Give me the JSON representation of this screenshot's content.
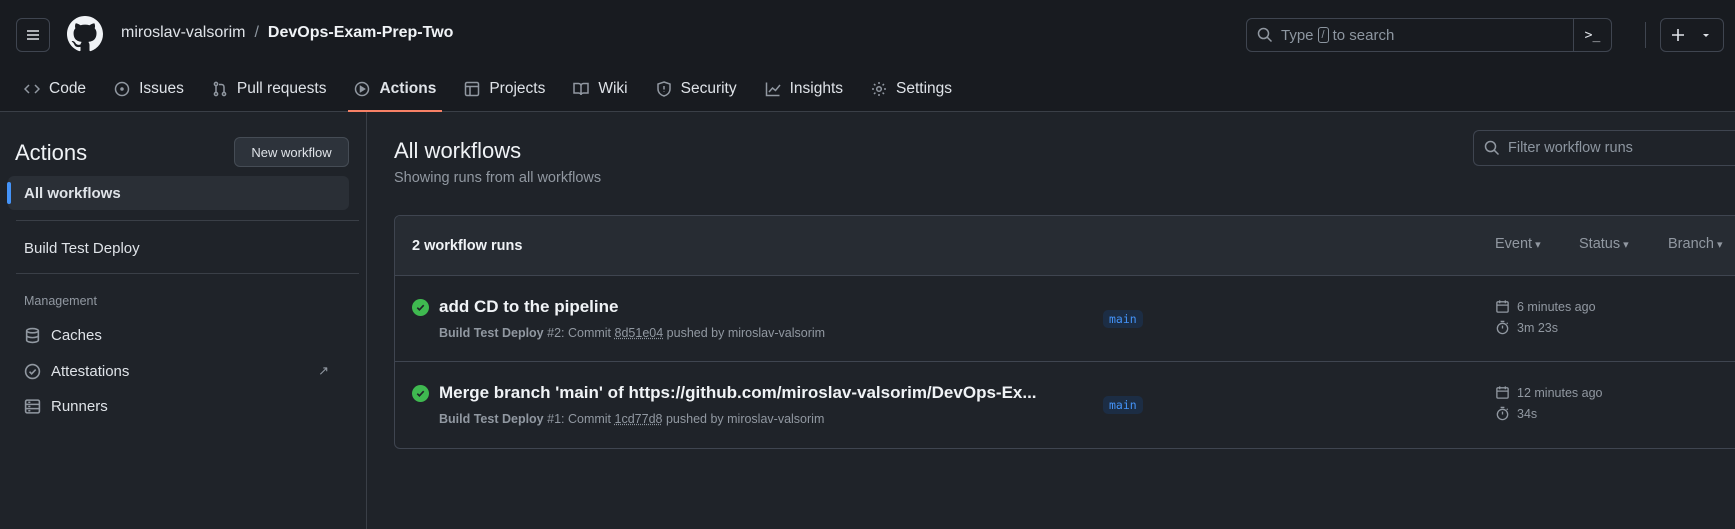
{
  "header": {
    "owner": "miroslav-valsorim",
    "separator": "/",
    "repo": "DevOps-Exam-Prep-Two",
    "search_prefix": "Type",
    "search_key": "/",
    "search_suffix": "to search",
    "plus_icon": "plus-icon"
  },
  "tabs": [
    {
      "label": "Code",
      "icon": "code-icon"
    },
    {
      "label": "Issues",
      "icon": "issue-icon"
    },
    {
      "label": "Pull requests",
      "icon": "pull-request-icon"
    },
    {
      "label": "Actions",
      "icon": "play-icon",
      "active": true
    },
    {
      "label": "Projects",
      "icon": "table-icon"
    },
    {
      "label": "Wiki",
      "icon": "book-icon"
    },
    {
      "label": "Security",
      "icon": "shield-icon"
    },
    {
      "label": "Insights",
      "icon": "graph-icon"
    },
    {
      "label": "Settings",
      "icon": "gear-icon"
    }
  ],
  "sidebar": {
    "title": "Actions",
    "new_workflow": "New workflow",
    "all_workflows": "All workflows",
    "workflow": "Build Test Deploy",
    "section": "Management",
    "items": [
      {
        "label": "Caches",
        "icon": "database-icon"
      },
      {
        "label": "Attestations",
        "icon": "verified-icon"
      },
      {
        "label": "Runners",
        "icon": "server-icon"
      }
    ]
  },
  "main": {
    "title": "All workflows",
    "subtitle": "Showing runs from all workflows",
    "filter_placeholder": "Filter workflow runs",
    "runs_count": "2 workflow runs",
    "filters": [
      "Event",
      "Status",
      "Branch"
    ],
    "runs": [
      {
        "title": "add CD to the pipeline",
        "workflow": "Build Test Deploy",
        "run": "#2: Commit",
        "sha": "8d51e04",
        "pushed": "pushed by miroslav-valsorim",
        "branch": "main",
        "time": "6 minutes ago",
        "duration": "3m 23s",
        "status": "success"
      },
      {
        "title": "Merge branch 'main' of https://github.com/miroslav-valsorim/DevOps-Ex...",
        "workflow": "Build Test Deploy",
        "run": "#1: Commit",
        "sha": "1cd77d8",
        "pushed": "pushed by miroslav-valsorim",
        "branch": "main",
        "time": "12 minutes ago",
        "duration": "34s",
        "status": "success"
      }
    ]
  },
  "colors": {
    "accent": "#f78166",
    "success": "#3fb950",
    "link": "#4493f8"
  }
}
